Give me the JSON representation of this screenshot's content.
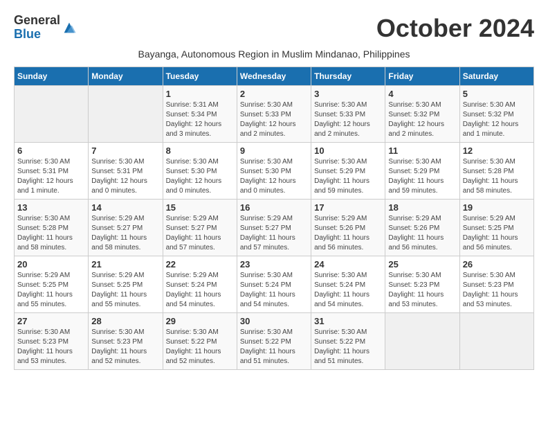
{
  "logo": {
    "general": "General",
    "blue": "Blue"
  },
  "title": "October 2024",
  "subtitle": "Bayanga, Autonomous Region in Muslim Mindanao, Philippines",
  "headers": [
    "Sunday",
    "Monday",
    "Tuesday",
    "Wednesday",
    "Thursday",
    "Friday",
    "Saturday"
  ],
  "weeks": [
    [
      {
        "day": "",
        "info": ""
      },
      {
        "day": "",
        "info": ""
      },
      {
        "day": "1",
        "info": "Sunrise: 5:31 AM\nSunset: 5:34 PM\nDaylight: 12 hours and 3 minutes."
      },
      {
        "day": "2",
        "info": "Sunrise: 5:30 AM\nSunset: 5:33 PM\nDaylight: 12 hours and 2 minutes."
      },
      {
        "day": "3",
        "info": "Sunrise: 5:30 AM\nSunset: 5:33 PM\nDaylight: 12 hours and 2 minutes."
      },
      {
        "day": "4",
        "info": "Sunrise: 5:30 AM\nSunset: 5:32 PM\nDaylight: 12 hours and 2 minutes."
      },
      {
        "day": "5",
        "info": "Sunrise: 5:30 AM\nSunset: 5:32 PM\nDaylight: 12 hours and 1 minute."
      }
    ],
    [
      {
        "day": "6",
        "info": "Sunrise: 5:30 AM\nSunset: 5:31 PM\nDaylight: 12 hours and 1 minute."
      },
      {
        "day": "7",
        "info": "Sunrise: 5:30 AM\nSunset: 5:31 PM\nDaylight: 12 hours and 0 minutes."
      },
      {
        "day": "8",
        "info": "Sunrise: 5:30 AM\nSunset: 5:30 PM\nDaylight: 12 hours and 0 minutes."
      },
      {
        "day": "9",
        "info": "Sunrise: 5:30 AM\nSunset: 5:30 PM\nDaylight: 12 hours and 0 minutes."
      },
      {
        "day": "10",
        "info": "Sunrise: 5:30 AM\nSunset: 5:29 PM\nDaylight: 11 hours and 59 minutes."
      },
      {
        "day": "11",
        "info": "Sunrise: 5:30 AM\nSunset: 5:29 PM\nDaylight: 11 hours and 59 minutes."
      },
      {
        "day": "12",
        "info": "Sunrise: 5:30 AM\nSunset: 5:28 PM\nDaylight: 11 hours and 58 minutes."
      }
    ],
    [
      {
        "day": "13",
        "info": "Sunrise: 5:30 AM\nSunset: 5:28 PM\nDaylight: 11 hours and 58 minutes."
      },
      {
        "day": "14",
        "info": "Sunrise: 5:29 AM\nSunset: 5:27 PM\nDaylight: 11 hours and 58 minutes."
      },
      {
        "day": "15",
        "info": "Sunrise: 5:29 AM\nSunset: 5:27 PM\nDaylight: 11 hours and 57 minutes."
      },
      {
        "day": "16",
        "info": "Sunrise: 5:29 AM\nSunset: 5:27 PM\nDaylight: 11 hours and 57 minutes."
      },
      {
        "day": "17",
        "info": "Sunrise: 5:29 AM\nSunset: 5:26 PM\nDaylight: 11 hours and 56 minutes."
      },
      {
        "day": "18",
        "info": "Sunrise: 5:29 AM\nSunset: 5:26 PM\nDaylight: 11 hours and 56 minutes."
      },
      {
        "day": "19",
        "info": "Sunrise: 5:29 AM\nSunset: 5:25 PM\nDaylight: 11 hours and 56 minutes."
      }
    ],
    [
      {
        "day": "20",
        "info": "Sunrise: 5:29 AM\nSunset: 5:25 PM\nDaylight: 11 hours and 55 minutes."
      },
      {
        "day": "21",
        "info": "Sunrise: 5:29 AM\nSunset: 5:25 PM\nDaylight: 11 hours and 55 minutes."
      },
      {
        "day": "22",
        "info": "Sunrise: 5:29 AM\nSunset: 5:24 PM\nDaylight: 11 hours and 54 minutes."
      },
      {
        "day": "23",
        "info": "Sunrise: 5:30 AM\nSunset: 5:24 PM\nDaylight: 11 hours and 54 minutes."
      },
      {
        "day": "24",
        "info": "Sunrise: 5:30 AM\nSunset: 5:24 PM\nDaylight: 11 hours and 54 minutes."
      },
      {
        "day": "25",
        "info": "Sunrise: 5:30 AM\nSunset: 5:23 PM\nDaylight: 11 hours and 53 minutes."
      },
      {
        "day": "26",
        "info": "Sunrise: 5:30 AM\nSunset: 5:23 PM\nDaylight: 11 hours and 53 minutes."
      }
    ],
    [
      {
        "day": "27",
        "info": "Sunrise: 5:30 AM\nSunset: 5:23 PM\nDaylight: 11 hours and 53 minutes."
      },
      {
        "day": "28",
        "info": "Sunrise: 5:30 AM\nSunset: 5:23 PM\nDaylight: 11 hours and 52 minutes."
      },
      {
        "day": "29",
        "info": "Sunrise: 5:30 AM\nSunset: 5:22 PM\nDaylight: 11 hours and 52 minutes."
      },
      {
        "day": "30",
        "info": "Sunrise: 5:30 AM\nSunset: 5:22 PM\nDaylight: 11 hours and 51 minutes."
      },
      {
        "day": "31",
        "info": "Sunrise: 5:30 AM\nSunset: 5:22 PM\nDaylight: 11 hours and 51 minutes."
      },
      {
        "day": "",
        "info": ""
      },
      {
        "day": "",
        "info": ""
      }
    ]
  ]
}
